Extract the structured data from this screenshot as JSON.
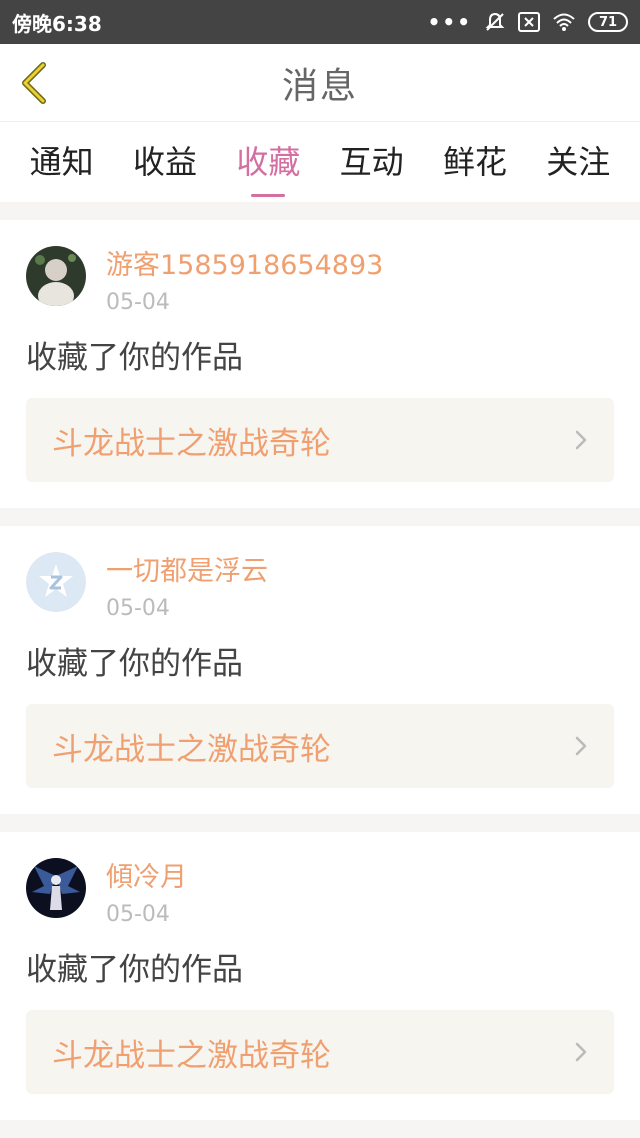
{
  "status_bar": {
    "time": "傍晚6:38",
    "dots": "•••",
    "battery": "71",
    "icons": [
      "bell-mute-icon",
      "sim-error-icon",
      "wifi-icon",
      "battery-icon"
    ]
  },
  "header": {
    "title": "消息",
    "back_icon": "chevron-left-icon"
  },
  "tabs": [
    {
      "label": "通知"
    },
    {
      "label": "收益"
    },
    {
      "label": "收藏"
    },
    {
      "label": "互动"
    },
    {
      "label": "鲜花"
    },
    {
      "label": "关注"
    }
  ],
  "active_tab": "收藏",
  "colors": {
    "accent": "#d46fa1",
    "name": "#f0a070",
    "status_bar": "#444444"
  },
  "messages": [
    {
      "user": "游客1585918654893",
      "date": "05-04",
      "action": "收藏了你的作品",
      "work": "斗龙战士之激战奇轮"
    },
    {
      "user": "一切都是浮云",
      "date": "05-04",
      "action": "收藏了你的作品",
      "work": "斗龙战士之激战奇轮"
    },
    {
      "user": "傾冷月",
      "date": "05-04",
      "action": "收藏了你的作品",
      "work": "斗龙战士之激战奇轮"
    }
  ]
}
